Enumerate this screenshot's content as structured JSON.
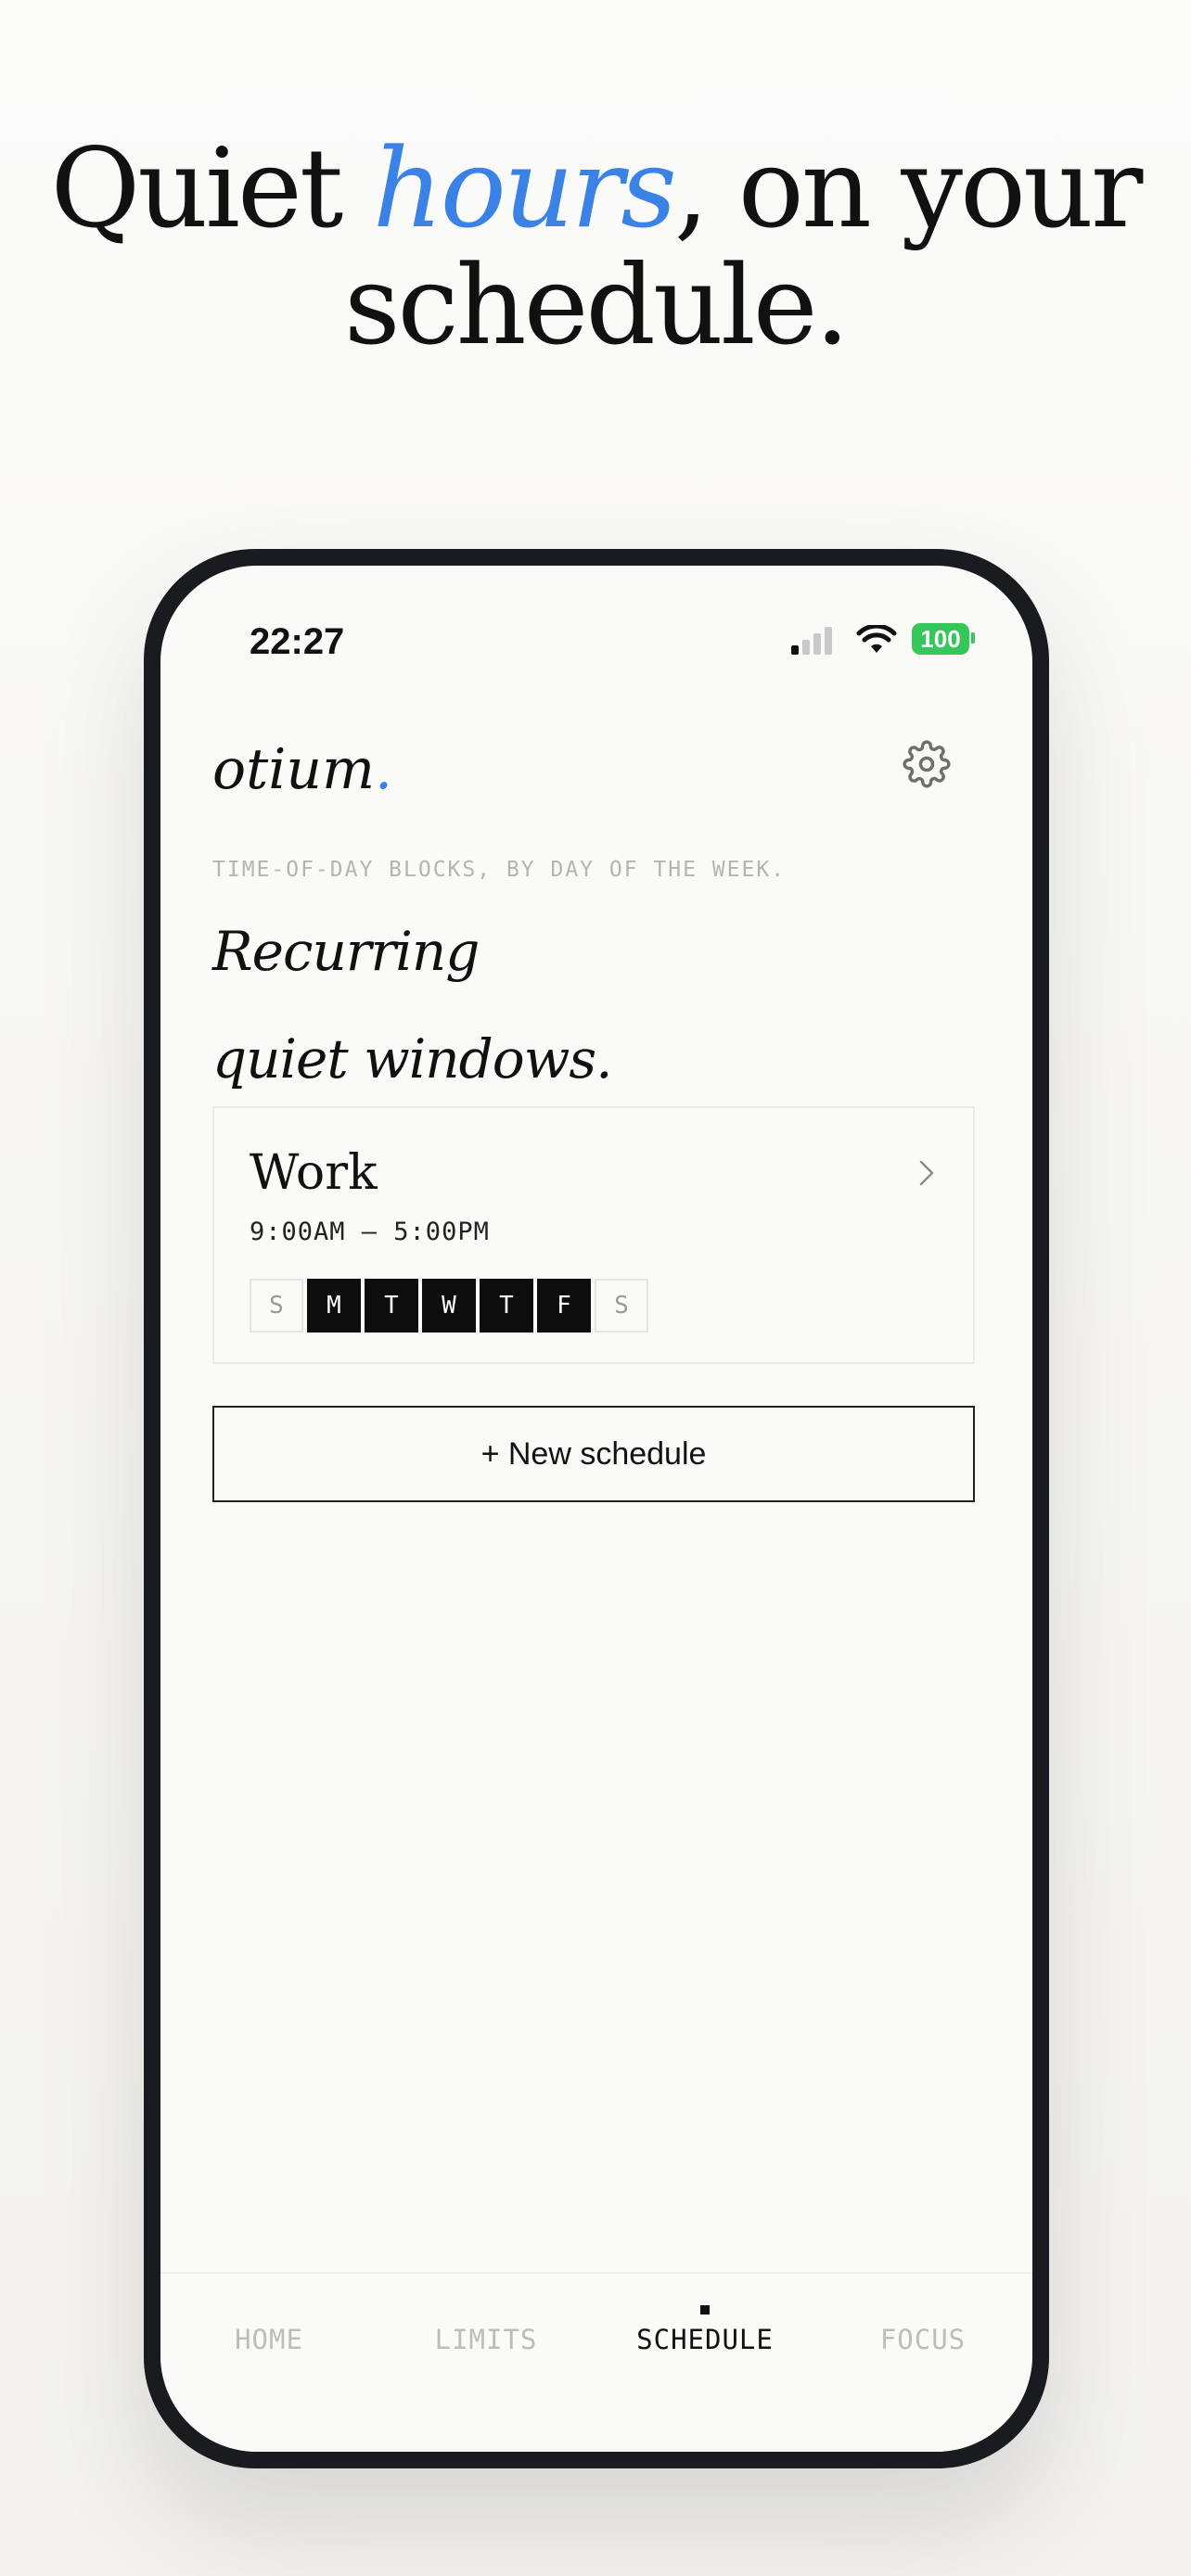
{
  "hero": {
    "line1_pre": "Quiet ",
    "line1_accent": "hours",
    "line1_post": ", on your",
    "line2": "schedule."
  },
  "status_bar": {
    "time": "22:27",
    "battery": "100"
  },
  "app": {
    "brand": "otium",
    "brand_dot": ".",
    "eyebrow": "TIME-OF-DAY BLOCKS, BY DAY OF THE WEEK.",
    "headline_line1": "Recurring",
    "headline_line2": "quiet windows."
  },
  "schedules": [
    {
      "name": "Work",
      "time_range": "9:00AM — 5:00PM",
      "days": [
        {
          "label": "S",
          "active": false
        },
        {
          "label": "M",
          "active": true
        },
        {
          "label": "T",
          "active": true
        },
        {
          "label": "W",
          "active": true
        },
        {
          "label": "T",
          "active": true
        },
        {
          "label": "F",
          "active": true
        },
        {
          "label": "S",
          "active": false
        }
      ]
    }
  ],
  "new_schedule_button": "+  New schedule",
  "tabs": [
    {
      "label": "HOME",
      "active": false
    },
    {
      "label": "LIMITS",
      "active": false
    },
    {
      "label": "SCHEDULE",
      "active": true
    },
    {
      "label": "FOCUS",
      "active": false
    }
  ],
  "colors": {
    "accent": "#3b82e6",
    "battery": "#34c759",
    "day_active": "#0d0d0d"
  }
}
